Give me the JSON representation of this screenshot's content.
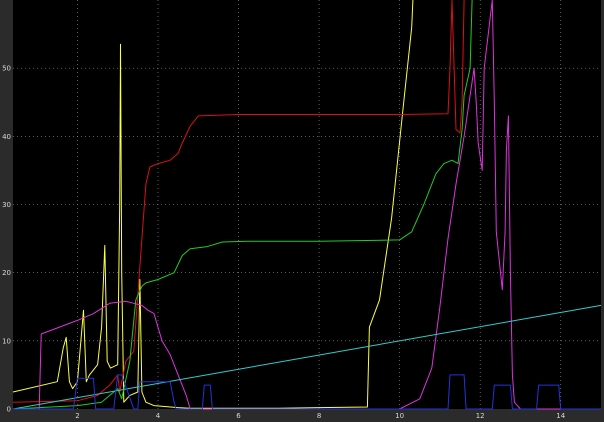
{
  "chart_data": {
    "type": "line",
    "title": "",
    "xlabel": "",
    "ylabel": "",
    "xlim": [
      0.4,
      15.0
    ],
    "ylim": [
      0,
      60
    ],
    "grid": true,
    "background": "#000000",
    "frame_color": "#2b2b2b",
    "grid_color": "#9a9a9a",
    "x_ticks": [
      2,
      4,
      6,
      8,
      10,
      12,
      14
    ],
    "y_ticks": [
      0,
      10,
      20,
      30,
      40,
      50
    ],
    "series": [
      {
        "color": "#ffff44",
        "x": [
          0.4,
          1.5,
          1.65,
          1.72,
          1.8,
          1.88,
          2.0,
          2.15,
          2.22,
          2.3,
          2.5,
          2.6,
          2.68,
          2.74,
          2.82,
          3.0,
          3.05,
          3.07,
          3.1,
          3.15,
          3.3,
          3.5,
          3.55,
          3.6,
          3.7,
          3.9,
          4.5,
          4.8,
          5.5,
          7.0,
          8.0,
          9.2,
          9.25,
          9.5,
          9.8,
          10.1,
          10.3,
          10.33
        ],
        "y": [
          2.5,
          4.0,
          9.0,
          10.5,
          4.0,
          3.0,
          4.0,
          14.5,
          4.0,
          5.0,
          6.5,
          12.0,
          24.0,
          7.0,
          6.0,
          6.5,
          30.0,
          53.5,
          20.0,
          1.0,
          2.0,
          2.5,
          19.0,
          2.5,
          1.0,
          0.5,
          0.2,
          0.1,
          0.1,
          0.1,
          0.2,
          0.3,
          12.0,
          16.0,
          28.0,
          45.0,
          56.0,
          60.0
        ]
      },
      {
        "color": "#dd1111",
        "x": [
          0.4,
          2.0,
          2.5,
          2.8,
          3.0,
          3.05,
          3.2,
          3.4,
          3.6,
          3.7,
          3.8,
          4.0,
          4.3,
          4.5,
          4.6,
          4.8,
          5.0,
          6.0,
          8.0,
          10.0,
          11.2,
          11.25,
          11.3,
          11.4,
          11.5,
          11.55,
          11.6
        ],
        "y": [
          1.0,
          1.2,
          2.0,
          3.5,
          5.0,
          2.5,
          7.0,
          8.5,
          25.0,
          33.0,
          35.5,
          36.0,
          36.5,
          37.5,
          39.0,
          41.5,
          43.0,
          43.2,
          43.2,
          43.2,
          43.3,
          50.0,
          60.0,
          41.0,
          40.5,
          45.0,
          60.0
        ]
      },
      {
        "color": "#22cc22",
        "x": [
          0.4,
          2.0,
          2.6,
          3.0,
          3.1,
          3.3,
          3.45,
          3.6,
          3.7,
          4.0,
          4.4,
          4.6,
          4.8,
          5.2,
          5.6,
          6.2,
          8.0,
          10.0,
          10.3,
          10.6,
          10.9,
          11.1,
          11.3,
          11.45,
          11.55,
          11.6,
          11.75,
          11.8
        ],
        "y": [
          0.0,
          0.5,
          1.0,
          3.0,
          1.5,
          7.0,
          16.0,
          18.0,
          18.5,
          19.0,
          20.0,
          22.5,
          23.5,
          23.8,
          24.5,
          24.6,
          24.6,
          24.8,
          26.0,
          30.0,
          34.5,
          36.0,
          36.5,
          36.0,
          41.0,
          46.0,
          50.0,
          60.0
        ]
      },
      {
        "color": "#dd33dd",
        "x": [
          0.4,
          1.05,
          1.1,
          2.0,
          2.4,
          2.8,
          3.2,
          3.4,
          3.6,
          3.75,
          3.9,
          4.1,
          4.3,
          4.5,
          4.7,
          4.8,
          10.0,
          10.5,
          10.8,
          11.0,
          11.2,
          11.4,
          11.6,
          11.75,
          11.85,
          11.9,
          11.95,
          12.05,
          12.1,
          12.3,
          12.35,
          12.4,
          12.55,
          12.62,
          12.65,
          12.7,
          12.75,
          12.8,
          12.85,
          13.0,
          14.0,
          15.0
        ],
        "y": [
          0.0,
          0.0,
          11.0,
          13.0,
          14.0,
          15.5,
          15.8,
          15.5,
          15.2,
          14.5,
          14.0,
          10.0,
          8.0,
          5.0,
          2.0,
          0.0,
          0.0,
          1.5,
          6.0,
          15.0,
          25.0,
          33.0,
          40.0,
          46.0,
          50.0,
          45.0,
          39.0,
          35.0,
          50.0,
          60.0,
          45.0,
          26.0,
          17.5,
          26.0,
          38.0,
          43.0,
          20.0,
          5.0,
          1.0,
          0.0,
          0.0,
          0.0
        ]
      },
      {
        "color": "#33cccc",
        "x": [
          0.4,
          15.0
        ],
        "y": [
          0.0,
          15.2
        ]
      },
      {
        "color": "#2233dd",
        "x": [
          0.4,
          1.9,
          2.0,
          2.4,
          2.45,
          2.9,
          3.0,
          3.1,
          3.4,
          3.5,
          3.55,
          3.6,
          4.3,
          4.4,
          4.45,
          5.1,
          5.15,
          5.3,
          5.35,
          11.2,
          11.25,
          11.6,
          11.65,
          12.3,
          12.35,
          12.75,
          12.8,
          13.4,
          13.45,
          13.95,
          14.0,
          15.0
        ],
        "y": [
          0.0,
          0.0,
          4.5,
          4.5,
          0.0,
          0.0,
          5.0,
          5.0,
          0.0,
          0.0,
          4.0,
          4.0,
          4.0,
          1.0,
          0.0,
          0.0,
          3.5,
          3.5,
          0.0,
          0.0,
          5.0,
          5.0,
          0.0,
          0.0,
          3.5,
          3.5,
          0.0,
          0.0,
          3.5,
          3.5,
          0.0,
          0.0
        ]
      }
    ]
  }
}
